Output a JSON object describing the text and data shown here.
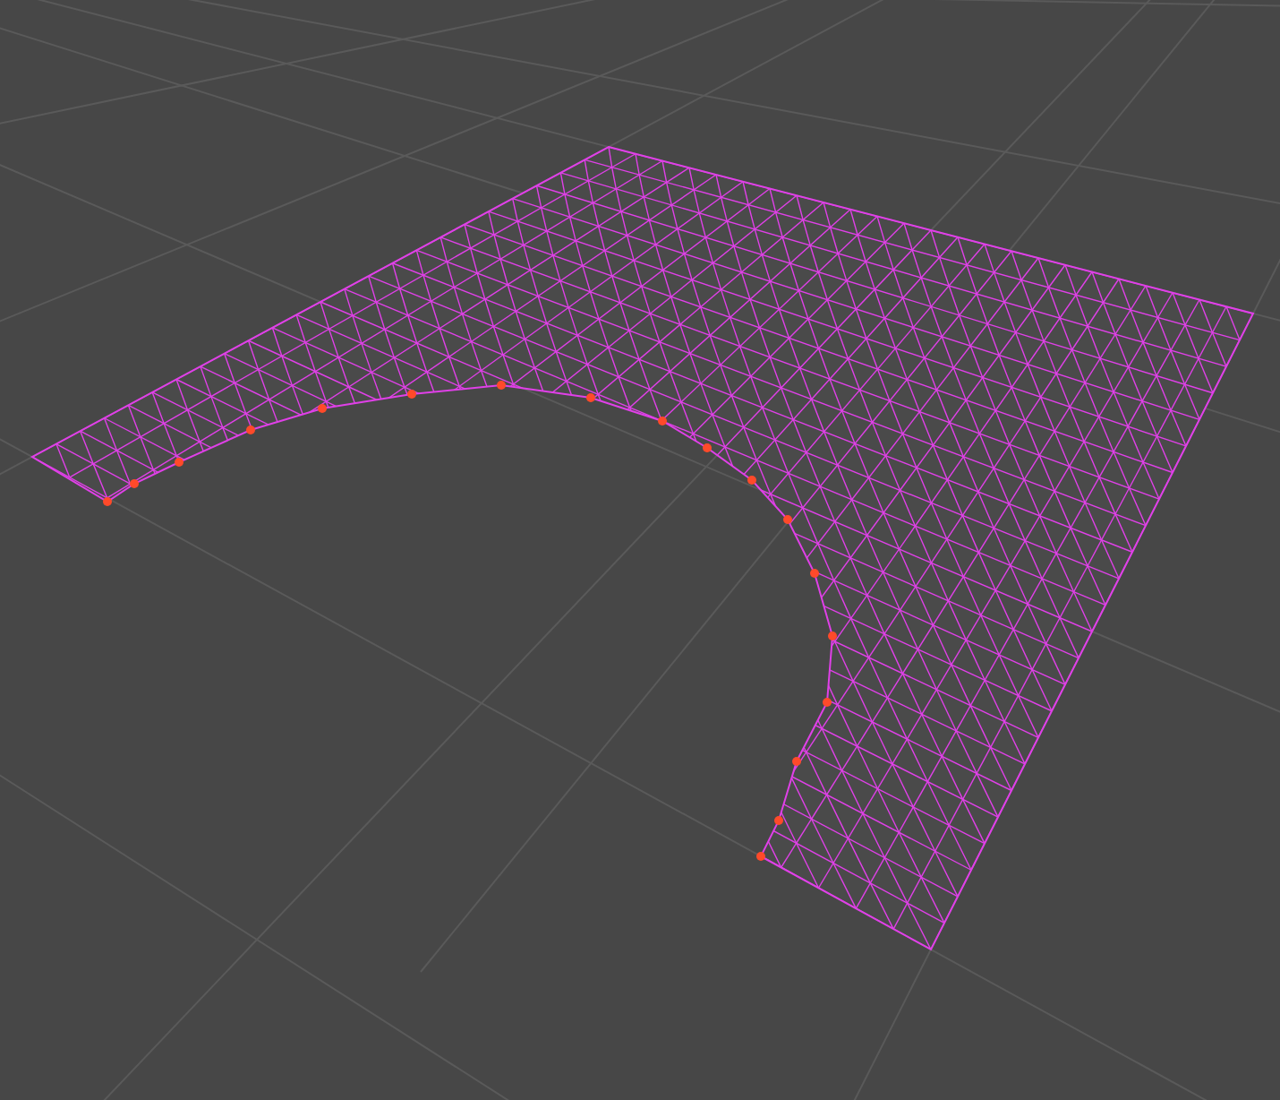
{
  "mesh": {
    "selected": true
  }
}
